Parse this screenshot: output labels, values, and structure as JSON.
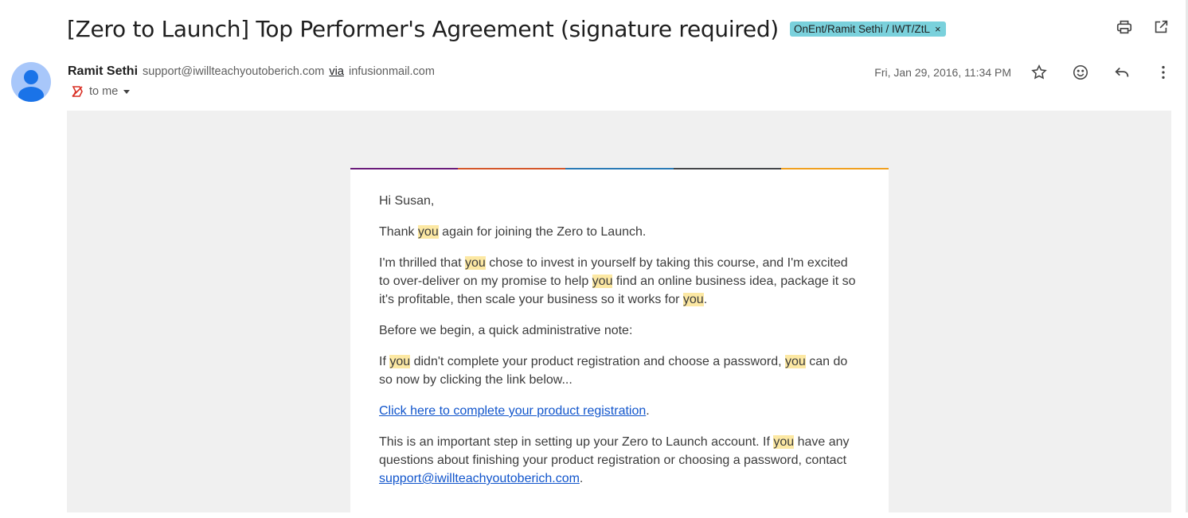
{
  "subject": "[Zero to Launch] Top Performer's Agreement (signature required)",
  "label": "OnEnt/Ramit Sethi / IWT/ZtL",
  "label_remove": "×",
  "top_actions": [
    "print-icon",
    "open-in-new-window-icon"
  ],
  "sender": {
    "name": "Ramit Sethi",
    "email": "support@iwillteachyoutoberich.com",
    "via_label": "via",
    "via_domain": "infusionmail.com",
    "to_label": "to me",
    "date": "Fri, Jan 29, 2016, 11:34 PM"
  },
  "meta_actions": [
    "star-icon",
    "emoji-icon",
    "reply-icon",
    "more-vert-icon"
  ],
  "colors": {
    "label_chip": "#7ad1dc",
    "highlight": "#fce8a3",
    "link": "#1155cc",
    "bar": [
      "#6a1b7a",
      "#d4572a",
      "#2a7ab5",
      "#44464a",
      "#f0a020"
    ]
  },
  "body": {
    "greeting": "Hi Susan,",
    "p1": [
      "Thank ",
      "you",
      " again for joining the Zero to Launch."
    ],
    "p2": [
      "I'm thrilled that ",
      "you",
      " chose to invest in yourself by taking this course, and I'm excited to over-deliver on my promise to help ",
      "you",
      " find an online business idea, package it so it's profitable, then scale your business so it works for ",
      "you",
      "."
    ],
    "p3": "Before we begin, a quick administrative note:",
    "p4": [
      "If ",
      "you",
      " didn't complete your product registration and choose a password, ",
      "you",
      " can do so now by clicking the link below..."
    ],
    "link_text": "Click here to complete your product registration",
    "link_suffix": ".",
    "p5": [
      "This is an important step in setting up your Zero to Launch account. If ",
      "you",
      " have any questions about finishing your product registration or choosing a password, contact "
    ],
    "p5_link": "support@iwillteachyoutoberich.com",
    "p5_suffix": "."
  }
}
